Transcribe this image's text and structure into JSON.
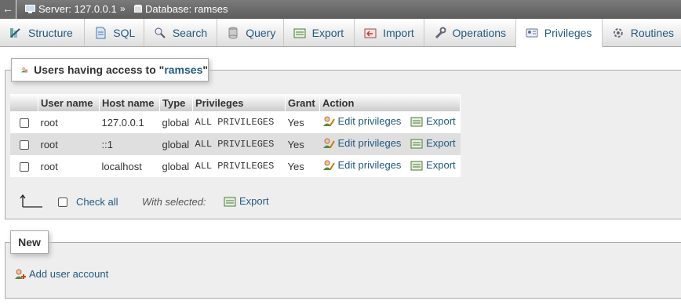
{
  "breadcrumb": {
    "back": "←",
    "server": "Server: 127.0.0.1",
    "separator": "»",
    "database": "Database: ramses"
  },
  "tabs": [
    {
      "label": "Structure",
      "icon": "structure-icon"
    },
    {
      "label": "SQL",
      "icon": "sql-icon"
    },
    {
      "label": "Search",
      "icon": "search-icon"
    },
    {
      "label": "Query",
      "icon": "query-icon"
    },
    {
      "label": "Export",
      "icon": "export-icon"
    },
    {
      "label": "Import",
      "icon": "import-icon"
    },
    {
      "label": "Operations",
      "icon": "wrench-icon"
    },
    {
      "label": "Privileges",
      "icon": "privileges-icon",
      "active": true
    },
    {
      "label": "Routines",
      "icon": "routines-icon"
    }
  ],
  "users_panel": {
    "legend_prefix": "Users having access to \"",
    "db_name": "ramses",
    "legend_suffix": "\""
  },
  "table": {
    "headers": [
      "User name",
      "Host name",
      "Type",
      "Privileges",
      "Grant",
      "Action"
    ],
    "rows": [
      {
        "user": "root",
        "host": "127.0.0.1",
        "type": "global",
        "privileges": "ALL PRIVILEGES",
        "grant": "Yes",
        "edit": "Edit privileges",
        "export": "Export"
      },
      {
        "user": "root",
        "host": "::1",
        "type": "global",
        "privileges": "ALL PRIVILEGES",
        "grant": "Yes",
        "edit": "Edit privileges",
        "export": "Export"
      },
      {
        "user": "root",
        "host": "localhost",
        "type": "global",
        "privileges": "ALL PRIVILEGES",
        "grant": "Yes",
        "edit": "Edit privileges",
        "export": "Export"
      }
    ]
  },
  "footer": {
    "check_all": "Check all",
    "with_selected": "With selected:",
    "export": "Export"
  },
  "new_panel": {
    "legend": "New",
    "add_user": "Add user account"
  },
  "colors": {
    "link": "#235a81",
    "panel_bg": "#eeeeee",
    "row_alt": "#dfdfdf"
  }
}
